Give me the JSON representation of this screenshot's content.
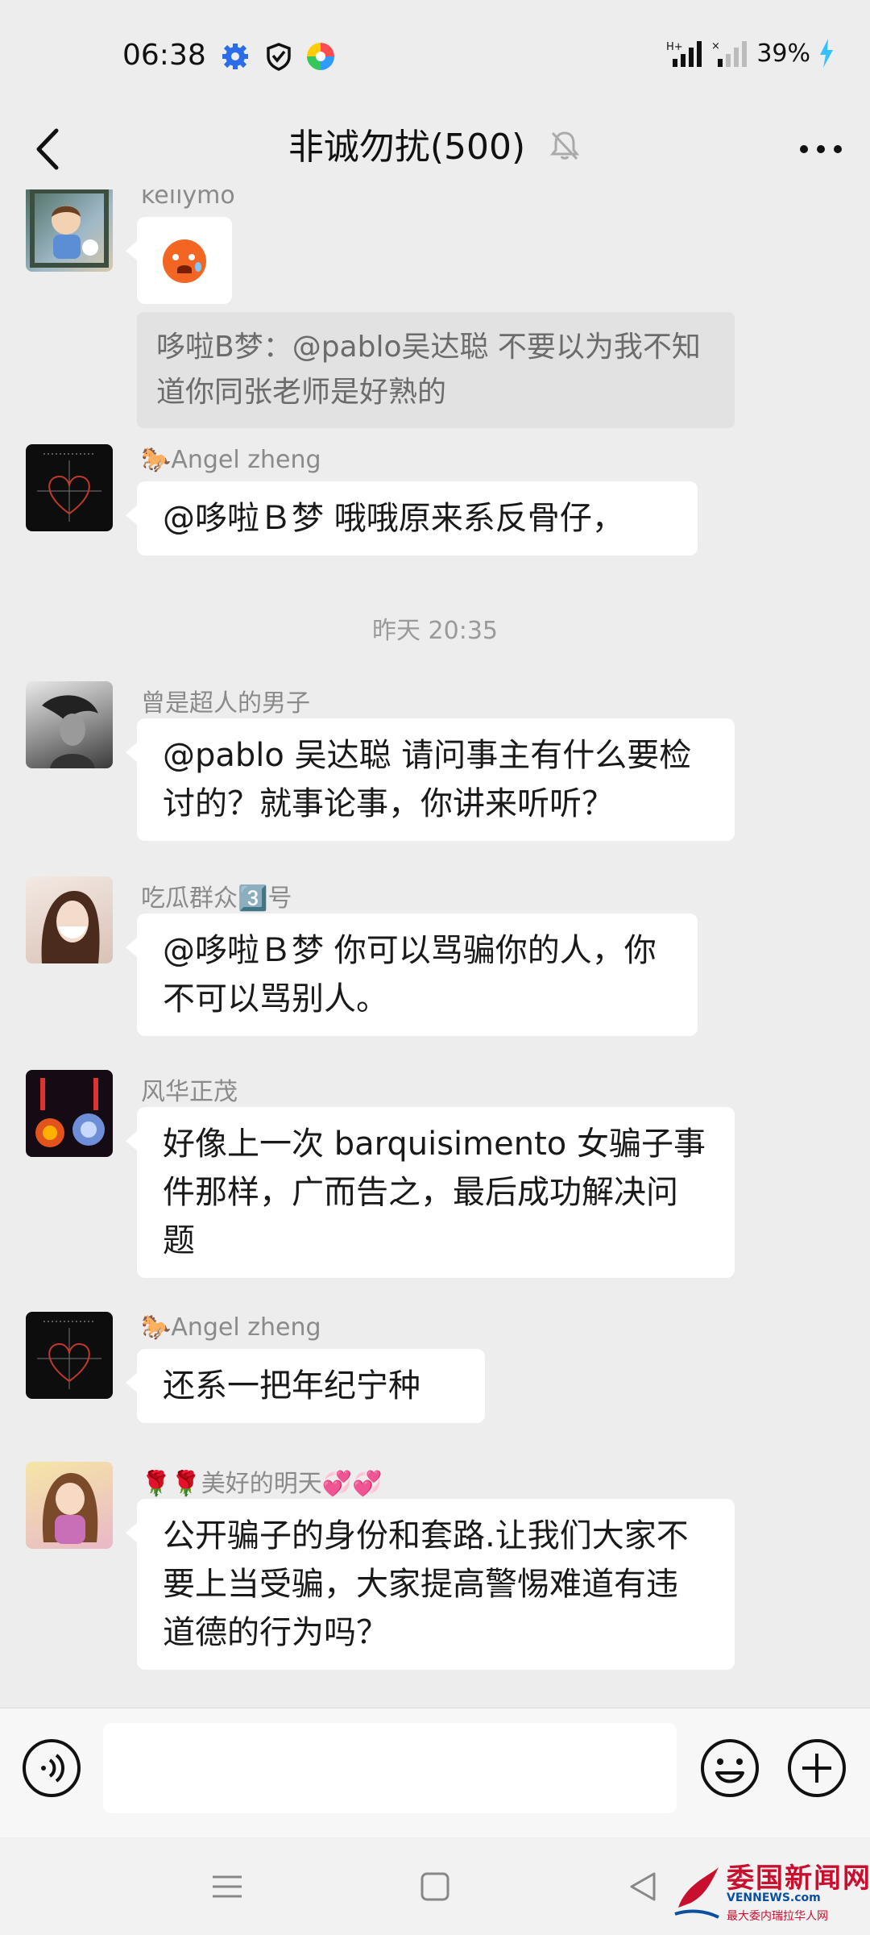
{
  "status_bar": {
    "time": "06:38",
    "battery": "39%",
    "icons": [
      "gear-icon",
      "shield-icon",
      "pinwheel-app-icon",
      "signal-hplus-icon",
      "signal-no-sim-icon",
      "charging-bolt-icon"
    ]
  },
  "header": {
    "title": "非诚勿扰(500)",
    "icons": [
      "back-chevron-icon",
      "muted-bell-icon",
      "more-dots-icon"
    ]
  },
  "messages": [
    {
      "sender": "kellymo",
      "type": "emoji",
      "emoji": "😨"
    },
    {
      "type": "quote",
      "text": "哆啦B梦：@pablo吴达聪 不要以为我不知道你同张老师是好熟的"
    },
    {
      "sender": "🐎Angel zheng",
      "text": "@哆啦Ｂ梦  哦哦原来系反骨仔，"
    },
    {
      "type": "timestamp",
      "text": "昨天 20:35"
    },
    {
      "sender": "曾是超人的男子",
      "text": "@pablo 吴达聪  请问事主有什么要检讨的？就事论事，你讲来听听？"
    },
    {
      "sender": "吃瓜群众3️⃣号",
      "text": "@哆啦Ｂ梦  你可以骂骗你的人，你不可以骂别人。"
    },
    {
      "sender": "风华正茂",
      "text": "好像上一次 barquisimento 女骗子事件那样，广而告之，最后成功解决问题"
    },
    {
      "sender": "🐎Angel zheng",
      "text": "还系一把年纪宁种"
    },
    {
      "sender": "🌹🌹美好的明天💞💞",
      "text": "公开骗子的身份和套路.让我们大家不要上当受骗，大家提高警惕难道有违道德的行为吗？"
    }
  ],
  "input_bar": {
    "placeholder": "",
    "icons": [
      "voice-icon",
      "emoji-icon",
      "plus-icon"
    ]
  },
  "nav_bar": {
    "icons": [
      "menu-icon",
      "home-square-icon",
      "back-triangle-icon"
    ]
  },
  "watermark": {
    "main": "委国新闻网",
    "sub": "VENNEWS.com",
    "tagline": "最大委内瑞拉华人网"
  }
}
